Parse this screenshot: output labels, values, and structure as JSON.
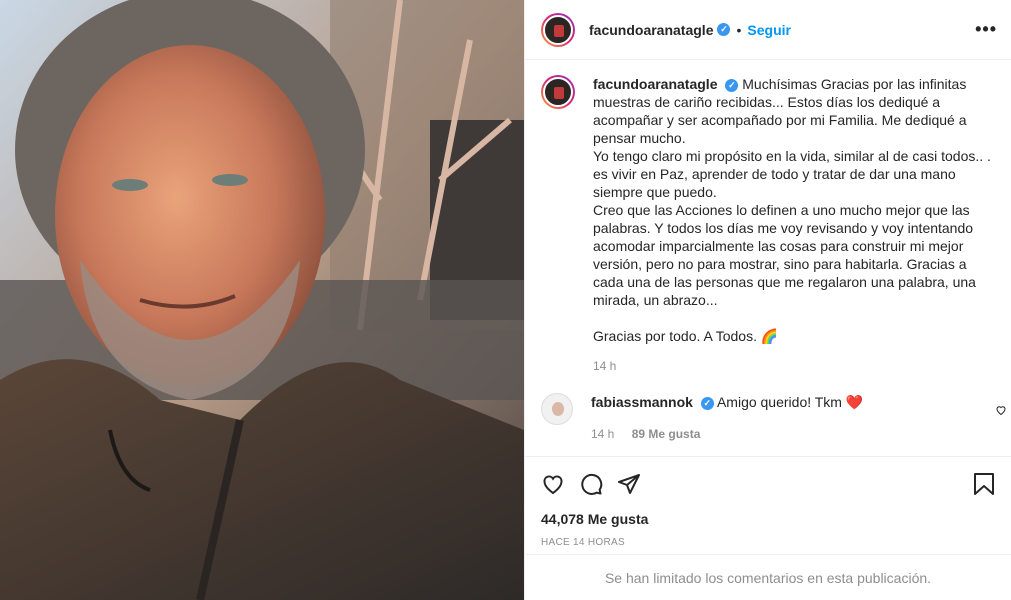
{
  "post": {
    "username": "facundoaranatagle",
    "follow_label": "Seguir",
    "more_label": "•••",
    "caption_user": "facundoaranatagle",
    "caption_text": "Muchísimas Gracias por las infinitas muestras de cariño recibidas... Estos días los dediqué a acompañar y ser acompañado por mi Familia. Me dediqué a pensar mucho.\nYo tengo claro mi propósito en la vida, similar al de casi todos.. . es vivir en Paz, aprender de todo y tratar de dar una mano siempre que puedo.\nCreo que las Acciones lo definen a uno mucho mejor que las palabras. Y todos los días me voy revisando y voy intentando acomodar imparcialmente las cosas para construir mi mejor versión, pero no para mostrar, sino para habitarla. Gracias a cada una de las personas que me regalaron una palabra, una mirada, un abrazo...\n\nGracias por todo. A Todos. 🌈",
    "caption_time": "14 h",
    "likes": "44,078 Me gusta",
    "time_ago": "HACE 14 HORAS",
    "comments_limited": "Se han limitado los comentarios en esta publicación."
  },
  "comments": [
    {
      "username": "fabiassmannok",
      "text": "Amigo querido! Tkm ❤️",
      "time": "14 h",
      "likes": "89 Me gusta"
    }
  ],
  "icons": {
    "like": "heart-icon",
    "comment": "comment-icon",
    "share": "share-icon",
    "save": "bookmark-icon",
    "verified": "verified-icon"
  },
  "colors": {
    "accent": "#0095f6",
    "verified": "#3897f0",
    "muted": "#8e8e8e",
    "heart": "#ed4956"
  }
}
